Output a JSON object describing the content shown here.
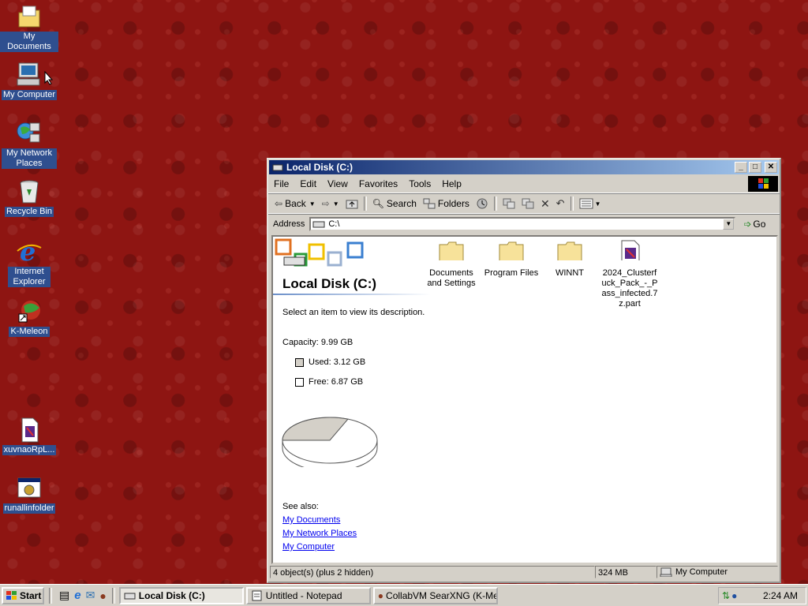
{
  "desktop": {
    "icons": [
      {
        "label": "My Documents",
        "icon": "my-documents-icon"
      },
      {
        "label": "My Computer",
        "icon": "my-computer-icon"
      },
      {
        "label": "My Network Places",
        "icon": "network-places-icon"
      },
      {
        "label": "Recycle Bin",
        "icon": "recycle-bin-icon"
      },
      {
        "label": "Internet Explorer",
        "icon": "internet-explorer-icon"
      },
      {
        "label": "K-Meleon",
        "icon": "k-meleon-icon"
      },
      {
        "label": "xuvnaoRpL...",
        "icon": "file-icon"
      },
      {
        "label": "runallinfolder",
        "icon": "batch-file-icon"
      }
    ]
  },
  "window": {
    "title": "Local Disk (C:)",
    "menu": [
      "File",
      "Edit",
      "View",
      "Favorites",
      "Tools",
      "Help"
    ],
    "toolbar": {
      "back": "Back",
      "search": "Search",
      "folders": "Folders"
    },
    "address": {
      "label": "Address",
      "value": "C:\\",
      "go": "Go"
    },
    "left_pane": {
      "title": "Local Disk (C:)",
      "description": "Select an item to view its description.",
      "capacity": "Capacity: 9.99 GB",
      "used": "Used: 3.12 GB",
      "free": "Free: 6.87 GB",
      "see_also": "See also:",
      "links": [
        "My Documents",
        "My Network Places",
        "My Computer"
      ]
    },
    "files": [
      {
        "name": "Documents and Settings",
        "line1": "Documents",
        "line2": "and Settings",
        "type": "folder"
      },
      {
        "name": "Program Files",
        "line1": "Program Files",
        "line2": "",
        "type": "folder"
      },
      {
        "name": "WINNT",
        "line1": "WINNT",
        "line2": "",
        "type": "folder"
      },
      {
        "name": "2024_Clusterfuck_Pack_-_Pass_infected.7z.part",
        "line1": "2024_Clusterf",
        "line2": "uck_Pack_-_P",
        "line3": "ass_infected.7",
        "line4": "z.part",
        "type": "file"
      }
    ],
    "status": {
      "objects": "4 object(s) (plus 2 hidden)",
      "size": "324 MB",
      "zone": "My Computer"
    }
  },
  "disk_usage": {
    "used_gb": 3.12,
    "free_gb": 6.87,
    "capacity_gb": 9.99
  },
  "taskbar": {
    "start": "Start",
    "tasks": [
      {
        "label": "Local Disk (C:)",
        "active": true
      },
      {
        "label": "Untitled - Notepad",
        "active": false
      },
      {
        "label": "CollabVM SearXNG (K-Mel...",
        "active": false
      }
    ],
    "clock": "2:24 AM"
  },
  "colors": {
    "desktop": "#8e1512",
    "titlebar": "#0a246a",
    "chrome": "#d4d0c8"
  }
}
